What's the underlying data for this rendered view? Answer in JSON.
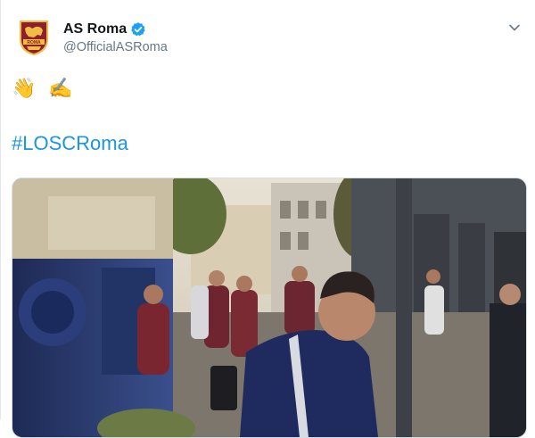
{
  "tweet": {
    "display_name": "AS Roma",
    "handle": "@OfficialASRoma",
    "emojis": [
      "👋",
      "✍️"
    ],
    "hashtag": "#LOSCRoma"
  },
  "icons": {
    "avatar": "as-roma-crest-logo",
    "verified": "verified-badge-icon",
    "menu": "chevron-down-icon"
  },
  "colors": {
    "link": "#1b95e0",
    "verified": "#1da1f2",
    "secondary_text": "#657786",
    "roma_red": "#8e1f2f",
    "roma_gold": "#f0bc42"
  },
  "media": {
    "type": "video-still",
    "description_icon": "video-frame"
  }
}
